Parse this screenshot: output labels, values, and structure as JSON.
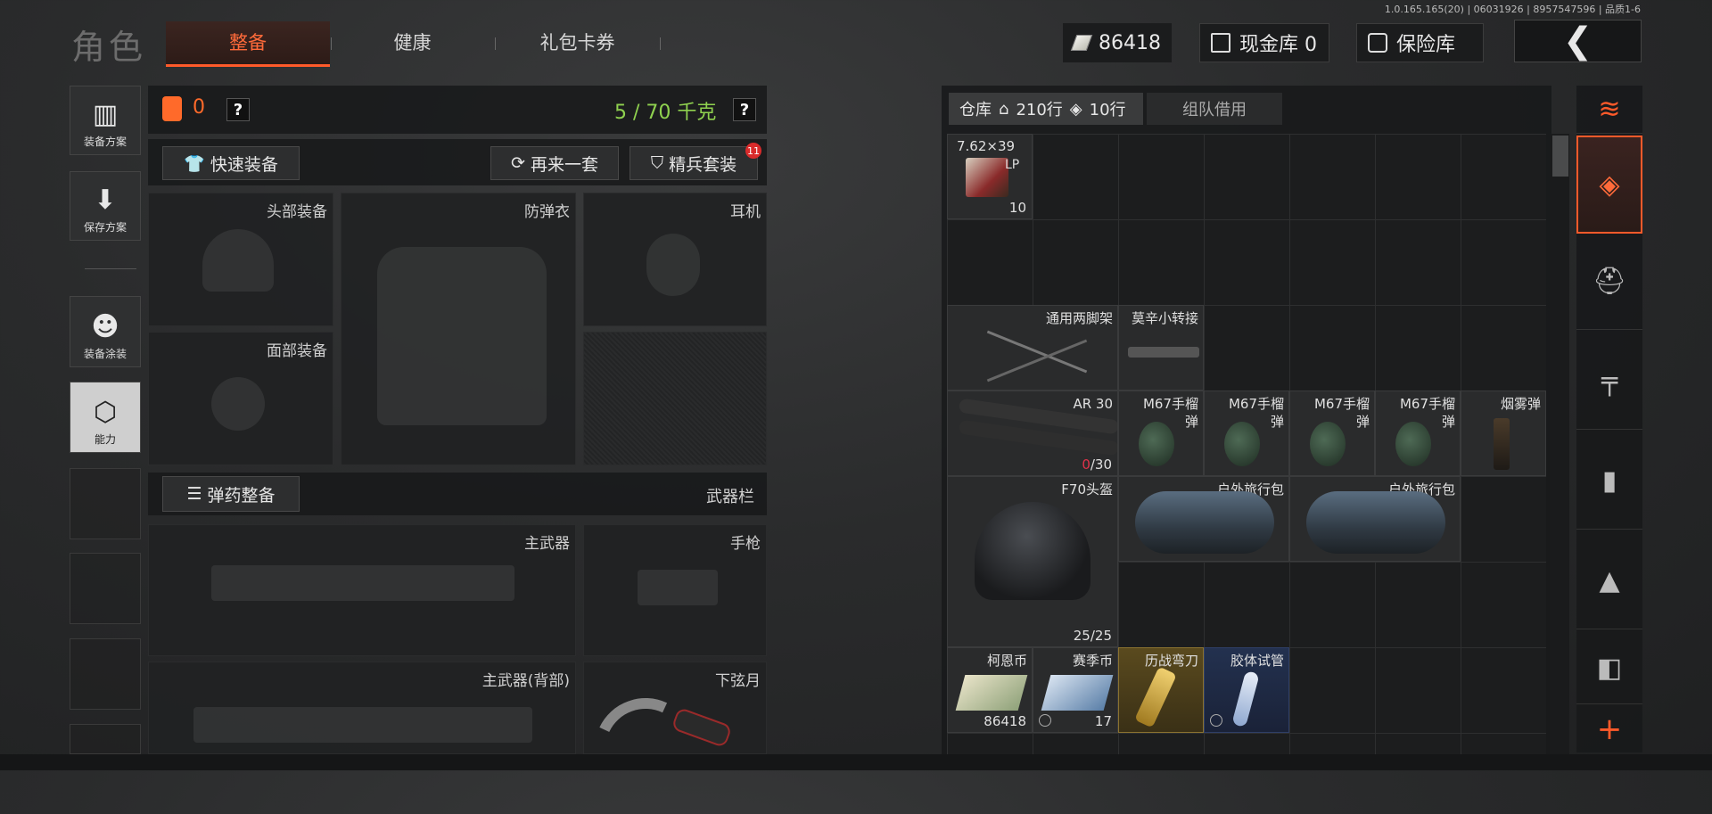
{
  "version": "1.0.165.165(20) | 06031926 | 8957547596 | 品质1-6",
  "header": {
    "title": "角色",
    "tabs": [
      {
        "label": "整备",
        "active": true
      },
      {
        "label": "健康",
        "active": false
      },
      {
        "label": "礼包卡券",
        "active": false
      }
    ],
    "currency": "86418",
    "cash_vault": "现金库 0",
    "safe_box": "保险库",
    "back_glyph": "❮"
  },
  "sidebar": {
    "items": [
      {
        "label": "装备方案",
        "icon": "vest-icon"
      },
      {
        "label": "保存方案",
        "icon": "download-icon"
      },
      {
        "label": "装备涂装",
        "icon": "operator-icon"
      },
      {
        "label": "能力",
        "icon": "ability-hex-icon"
      }
    ]
  },
  "loadout": {
    "armor_count": "0",
    "help": "?",
    "weight": "5 / 70 千克",
    "quick_equip": "快速装备",
    "reroll": "再来一套",
    "elite_kit": "精兵套装",
    "elite_badge": "11",
    "slots": {
      "head": "头部装备",
      "body_armor": "防弹衣",
      "headset": "耳机",
      "face": "面部装备",
      "primary": "主武器",
      "pistol": "手枪",
      "primary_back": "主武器(背部)",
      "melee": "下弦月"
    },
    "ammo_equip": "弹药整备",
    "weapon_bar": "武器栏"
  },
  "warehouse": {
    "tab_label": "仓库",
    "rows": "210行",
    "tickets": "10行",
    "team_borrow": "组队借用",
    "items": {
      "ammo": {
        "name": "7.62×39",
        "sub": "LP",
        "count": "10"
      },
      "bipod": {
        "name": "通用两脚架"
      },
      "adapter": {
        "name": "莫辛小转接"
      },
      "mag": {
        "name": "AR 30",
        "count_red": "0",
        "count_rest": "/30"
      },
      "grenades": [
        "M67手榴\n弹",
        "M67手榴\n弹",
        "M67手榴\n弹",
        "M67手榴\n弹"
      ],
      "smoke": {
        "name": "烟雾弹"
      },
      "helmet": {
        "name": "F70头盔",
        "count": "25/25"
      },
      "bag1": {
        "name": "户外旅行包"
      },
      "bag2": {
        "name": "户外旅行包"
      },
      "coin1": {
        "name": "柯恩币",
        "count": "86418"
      },
      "coin2": {
        "name": "赛季币",
        "count": "17"
      },
      "knife": {
        "name": "历战弯刀"
      },
      "tube": {
        "name": "胶体试管"
      }
    }
  },
  "colors": {
    "accent": "#ff5a2a",
    "weight_green": "#8fd14f",
    "gold": "#c9a33a",
    "blue_rarity": "#1f2a44"
  }
}
